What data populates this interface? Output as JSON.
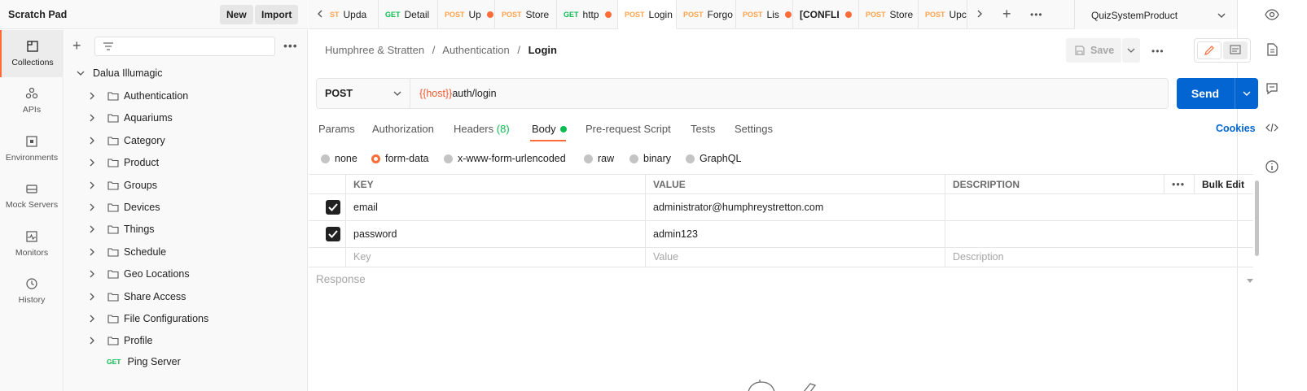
{
  "workspace": {
    "title": "Scratch Pad",
    "new_label": "New",
    "import_label": "Import"
  },
  "rail": [
    {
      "label": "Collections",
      "icon": "collections-icon",
      "active": true
    },
    {
      "label": "APIs",
      "icon": "apis-icon"
    },
    {
      "label": "Environments",
      "icon": "environments-icon"
    },
    {
      "label": "Mock Servers",
      "icon": "mock-servers-icon"
    },
    {
      "label": "Monitors",
      "icon": "monitors-icon"
    },
    {
      "label": "History",
      "icon": "history-icon"
    }
  ],
  "sidebar": {
    "collection": "Dalua Illumagic",
    "folders": [
      "Authentication",
      "Aquariums",
      "Category",
      "Product",
      "Groups",
      "Devices",
      "Things",
      "Schedule",
      "Geo Locations",
      "Share Access",
      "File Configurations",
      "Profile"
    ],
    "request": {
      "method": "GET",
      "name": "Ping Server"
    }
  },
  "tabs": [
    {
      "method": "ST",
      "name": "Upda",
      "dot": false
    },
    {
      "method": "GET",
      "name": "Detail",
      "dot": false
    },
    {
      "method": "POST",
      "name": "Up",
      "dot": true
    },
    {
      "method": "POST",
      "name": "Store",
      "dot": false
    },
    {
      "method": "GET",
      "name": "http",
      "dot": true
    },
    {
      "method": "POST",
      "name": "Login",
      "dot": false,
      "active": true
    },
    {
      "method": "POST",
      "name": "Forgo",
      "dot": false
    },
    {
      "method": "POST",
      "name": "Lis",
      "dot": true
    },
    {
      "method": "",
      "name": "[CONFLI",
      "dot": true
    },
    {
      "method": "POST",
      "name": "Store",
      "dot": false
    },
    {
      "method": "POST",
      "name": "Upc",
      "dot": false
    }
  ],
  "environment": {
    "name": "QuizSystemProduct"
  },
  "breadcrumb": {
    "part1": "Humphree & Stratten",
    "sep1": "/",
    "part2": "Authentication",
    "sep2": "/",
    "current": "Login"
  },
  "save_label": "Save",
  "request": {
    "method": "POST",
    "url_var": "{{host}}",
    "url_path": "auth/login",
    "send_label": "Send"
  },
  "request_tabs": {
    "params": "Params",
    "authorization": "Authorization",
    "headers": "Headers",
    "headers_count": "(8)",
    "body": "Body",
    "prerequest": "Pre-request Script",
    "tests": "Tests",
    "settings": "Settings",
    "cookies": "Cookies"
  },
  "body_types": [
    "none",
    "form-data",
    "x-www-form-urlencoded",
    "raw",
    "binary",
    "GraphQL"
  ],
  "body_selected": "form-data",
  "kv_table": {
    "headers": {
      "key": "KEY",
      "value": "VALUE",
      "description": "DESCRIPTION",
      "bulk_edit": "Bulk Edit"
    },
    "rows": [
      {
        "key": "email",
        "value": "administrator@humphreystretton.com",
        "checked": true
      },
      {
        "key": "password",
        "value": "admin123",
        "checked": true
      }
    ],
    "placeholders": {
      "key": "Key",
      "value": "Value",
      "description": "Description"
    }
  },
  "response": {
    "label": "Response"
  },
  "colors": {
    "accent": "#ff6c37",
    "send": "#0265d2",
    "post": "#ffa34d",
    "get": "#0cbb52"
  }
}
